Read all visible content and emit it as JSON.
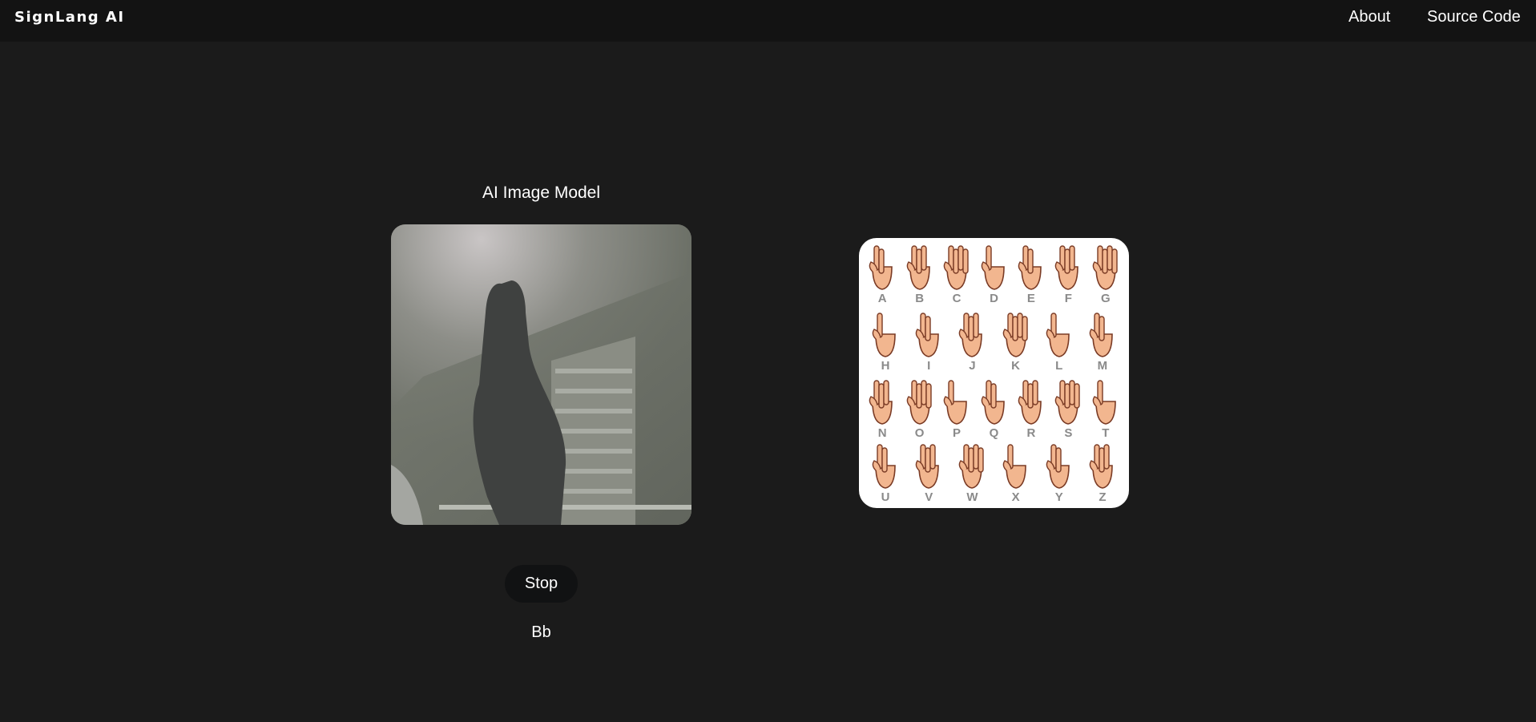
{
  "navbar": {
    "brand": "SignLang AI",
    "links": [
      {
        "label": "About"
      },
      {
        "label": "Source Code"
      }
    ]
  },
  "main": {
    "model_title": "AI Image Model",
    "stop_label": "Stop",
    "prediction": "Bb"
  },
  "asl_chart": {
    "rows": [
      [
        "A",
        "B",
        "C",
        "D",
        "E",
        "F",
        "G"
      ],
      [
        "H",
        "I",
        "J",
        "K",
        "L",
        "M"
      ],
      [
        "N",
        "O",
        "P",
        "Q",
        "R",
        "S",
        "T"
      ],
      [
        "U",
        "V",
        "W",
        "X",
        "Y",
        "Z"
      ]
    ]
  },
  "colors": {
    "background": "#1b1b1b",
    "navbar": "#131313",
    "button": "#111213",
    "skin": "#f2b68f",
    "letter": "#8a8a8a"
  }
}
